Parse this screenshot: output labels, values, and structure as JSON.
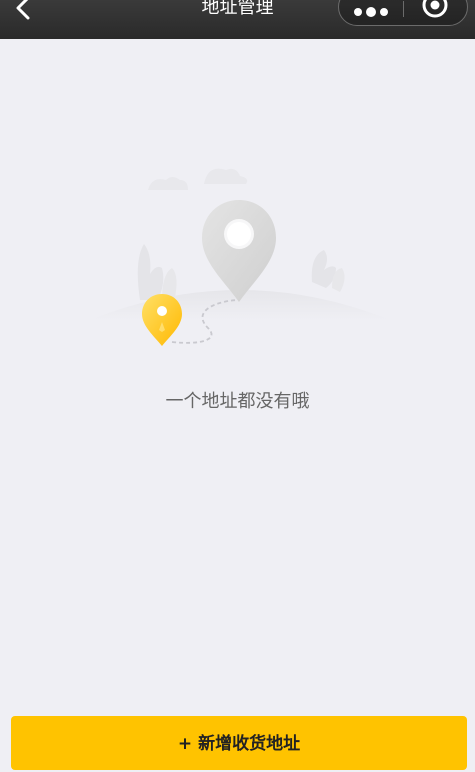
{
  "nav": {
    "title": "地址管理",
    "back_icon": "chevron-left-icon",
    "more_icon": "more-dots-icon",
    "close_icon": "target-circle-icon"
  },
  "empty_state": {
    "illustration_icon": "map-pin-illustration",
    "message": "一个地址都没有哦"
  },
  "footer": {
    "add_label": "+ 新增收货地址"
  },
  "colors": {
    "nav_bg": "#333333",
    "page_bg": "#efeff4",
    "accent": "#ffc300",
    "empty_text": "#666666"
  }
}
